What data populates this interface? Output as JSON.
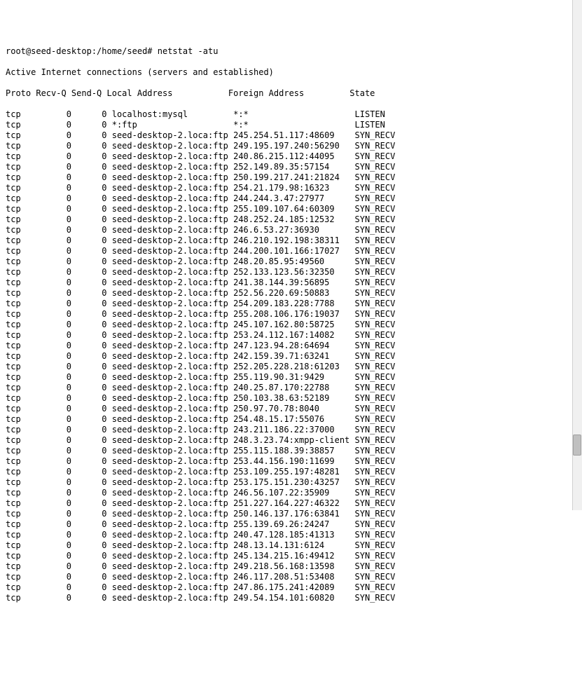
{
  "prompt": "root@seed-desktop:/home/seed# netstat -atu",
  "subtitle": "Active Internet connections (servers and established)",
  "columns": {
    "proto": "Proto",
    "recvq": "Recv-Q",
    "sendq": "Send-Q",
    "local": "Local Address",
    "foreign": "Foreign Address",
    "state": "State"
  },
  "rows": [
    {
      "proto": "tcp",
      "recvq": "0",
      "sendq": "0",
      "local": "localhost:mysql",
      "foreign": "*:*",
      "state": "LISTEN"
    },
    {
      "proto": "tcp",
      "recvq": "0",
      "sendq": "0",
      "local": "*:ftp",
      "foreign": "*:*",
      "state": "LISTEN"
    },
    {
      "proto": "tcp",
      "recvq": "0",
      "sendq": "0",
      "local": "seed-desktop-2.loca:ftp",
      "foreign": "245.254.51.117:48609",
      "state": "SYN_RECV"
    },
    {
      "proto": "tcp",
      "recvq": "0",
      "sendq": "0",
      "local": "seed-desktop-2.loca:ftp",
      "foreign": "249.195.197.240:56290",
      "state": "SYN_RECV"
    },
    {
      "proto": "tcp",
      "recvq": "0",
      "sendq": "0",
      "local": "seed-desktop-2.loca:ftp",
      "foreign": "240.86.215.112:44095",
      "state": "SYN_RECV"
    },
    {
      "proto": "tcp",
      "recvq": "0",
      "sendq": "0",
      "local": "seed-desktop-2.loca:ftp",
      "foreign": "252.149.89.35:57154",
      "state": "SYN_RECV"
    },
    {
      "proto": "tcp",
      "recvq": "0",
      "sendq": "0",
      "local": "seed-desktop-2.loca:ftp",
      "foreign": "250.199.217.241:21824",
      "state": "SYN_RECV"
    },
    {
      "proto": "tcp",
      "recvq": "0",
      "sendq": "0",
      "local": "seed-desktop-2.loca:ftp",
      "foreign": "254.21.179.98:16323",
      "state": "SYN_RECV"
    },
    {
      "proto": "tcp",
      "recvq": "0",
      "sendq": "0",
      "local": "seed-desktop-2.loca:ftp",
      "foreign": "244.244.3.47:27977",
      "state": "SYN_RECV"
    },
    {
      "proto": "tcp",
      "recvq": "0",
      "sendq": "0",
      "local": "seed-desktop-2.loca:ftp",
      "foreign": "255.109.107.64:60309",
      "state": "SYN_RECV"
    },
    {
      "proto": "tcp",
      "recvq": "0",
      "sendq": "0",
      "local": "seed-desktop-2.loca:ftp",
      "foreign": "248.252.24.185:12532",
      "state": "SYN_RECV"
    },
    {
      "proto": "tcp",
      "recvq": "0",
      "sendq": "0",
      "local": "seed-desktop-2.loca:ftp",
      "foreign": "246.6.53.27:36930",
      "state": "SYN_RECV"
    },
    {
      "proto": "tcp",
      "recvq": "0",
      "sendq": "0",
      "local": "seed-desktop-2.loca:ftp",
      "foreign": "246.210.192.198:38311",
      "state": "SYN_RECV"
    },
    {
      "proto": "tcp",
      "recvq": "0",
      "sendq": "0",
      "local": "seed-desktop-2.loca:ftp",
      "foreign": "244.200.101.166:17027",
      "state": "SYN_RECV"
    },
    {
      "proto": "tcp",
      "recvq": "0",
      "sendq": "0",
      "local": "seed-desktop-2.loca:ftp",
      "foreign": "248.20.85.95:49560",
      "state": "SYN_RECV"
    },
    {
      "proto": "tcp",
      "recvq": "0",
      "sendq": "0",
      "local": "seed-desktop-2.loca:ftp",
      "foreign": "252.133.123.56:32350",
      "state": "SYN_RECV"
    },
    {
      "proto": "tcp",
      "recvq": "0",
      "sendq": "0",
      "local": "seed-desktop-2.loca:ftp",
      "foreign": "241.38.144.39:56895",
      "state": "SYN_RECV"
    },
    {
      "proto": "tcp",
      "recvq": "0",
      "sendq": "0",
      "local": "seed-desktop-2.loca:ftp",
      "foreign": "252.56.220.69:50883",
      "state": "SYN_RECV"
    },
    {
      "proto": "tcp",
      "recvq": "0",
      "sendq": "0",
      "local": "seed-desktop-2.loca:ftp",
      "foreign": "254.209.183.228:7788",
      "state": "SYN_RECV"
    },
    {
      "proto": "tcp",
      "recvq": "0",
      "sendq": "0",
      "local": "seed-desktop-2.loca:ftp",
      "foreign": "255.208.106.176:19037",
      "state": "SYN_RECV"
    },
    {
      "proto": "tcp",
      "recvq": "0",
      "sendq": "0",
      "local": "seed-desktop-2.loca:ftp",
      "foreign": "245.107.162.80:58725",
      "state": "SYN_RECV"
    },
    {
      "proto": "tcp",
      "recvq": "0",
      "sendq": "0",
      "local": "seed-desktop-2.loca:ftp",
      "foreign": "253.24.112.167:14082",
      "state": "SYN_RECV"
    },
    {
      "proto": "tcp",
      "recvq": "0",
      "sendq": "0",
      "local": "seed-desktop-2.loca:ftp",
      "foreign": "247.123.94.28:64694",
      "state": "SYN_RECV"
    },
    {
      "proto": "tcp",
      "recvq": "0",
      "sendq": "0",
      "local": "seed-desktop-2.loca:ftp",
      "foreign": "242.159.39.71:63241",
      "state": "SYN_RECV"
    },
    {
      "proto": "tcp",
      "recvq": "0",
      "sendq": "0",
      "local": "seed-desktop-2.loca:ftp",
      "foreign": "252.205.228.218:61203",
      "state": "SYN_RECV"
    },
    {
      "proto": "tcp",
      "recvq": "0",
      "sendq": "0",
      "local": "seed-desktop-2.loca:ftp",
      "foreign": "255.119.90.31:9429",
      "state": "SYN_RECV"
    },
    {
      "proto": "tcp",
      "recvq": "0",
      "sendq": "0",
      "local": "seed-desktop-2.loca:ftp",
      "foreign": "240.25.87.170:22788",
      "state": "SYN_RECV"
    },
    {
      "proto": "tcp",
      "recvq": "0",
      "sendq": "0",
      "local": "seed-desktop-2.loca:ftp",
      "foreign": "250.103.38.63:52189",
      "state": "SYN_RECV"
    },
    {
      "proto": "tcp",
      "recvq": "0",
      "sendq": "0",
      "local": "seed-desktop-2.loca:ftp",
      "foreign": "250.97.70.78:8040",
      "state": "SYN_RECV"
    },
    {
      "proto": "tcp",
      "recvq": "0",
      "sendq": "0",
      "local": "seed-desktop-2.loca:ftp",
      "foreign": "254.48.15.17:55076",
      "state": "SYN_RECV"
    },
    {
      "proto": "tcp",
      "recvq": "0",
      "sendq": "0",
      "local": "seed-desktop-2.loca:ftp",
      "foreign": "243.211.186.22:37000",
      "state": "SYN_RECV"
    },
    {
      "proto": "tcp",
      "recvq": "0",
      "sendq": "0",
      "local": "seed-desktop-2.loca:ftp",
      "foreign": "248.3.23.74:xmpp-client",
      "state": "SYN_RECV"
    },
    {
      "proto": "tcp",
      "recvq": "0",
      "sendq": "0",
      "local": "seed-desktop-2.loca:ftp",
      "foreign": "255.115.188.39:38857",
      "state": "SYN_RECV"
    },
    {
      "proto": "tcp",
      "recvq": "0",
      "sendq": "0",
      "local": "seed-desktop-2.loca:ftp",
      "foreign": "253.44.156.190:11699",
      "state": "SYN_RECV"
    },
    {
      "proto": "tcp",
      "recvq": "0",
      "sendq": "0",
      "local": "seed-desktop-2.loca:ftp",
      "foreign": "253.109.255.197:48281",
      "state": "SYN_RECV"
    },
    {
      "proto": "tcp",
      "recvq": "0",
      "sendq": "0",
      "local": "seed-desktop-2.loca:ftp",
      "foreign": "253.175.151.230:43257",
      "state": "SYN_RECV"
    },
    {
      "proto": "tcp",
      "recvq": "0",
      "sendq": "0",
      "local": "seed-desktop-2.loca:ftp",
      "foreign": "246.56.107.22:35909",
      "state": "SYN_RECV"
    },
    {
      "proto": "tcp",
      "recvq": "0",
      "sendq": "0",
      "local": "seed-desktop-2.loca:ftp",
      "foreign": "251.227.164.227:46322",
      "state": "SYN_RECV"
    },
    {
      "proto": "tcp",
      "recvq": "0",
      "sendq": "0",
      "local": "seed-desktop-2.loca:ftp",
      "foreign": "250.146.137.176:63841",
      "state": "SYN_RECV"
    },
    {
      "proto": "tcp",
      "recvq": "0",
      "sendq": "0",
      "local": "seed-desktop-2.loca:ftp",
      "foreign": "255.139.69.26:24247",
      "state": "SYN_RECV"
    },
    {
      "proto": "tcp",
      "recvq": "0",
      "sendq": "0",
      "local": "seed-desktop-2.loca:ftp",
      "foreign": "240.47.128.185:41313",
      "state": "SYN_RECV"
    },
    {
      "proto": "tcp",
      "recvq": "0",
      "sendq": "0",
      "local": "seed-desktop-2.loca:ftp",
      "foreign": "248.13.14.131:6124",
      "state": "SYN_RECV"
    },
    {
      "proto": "tcp",
      "recvq": "0",
      "sendq": "0",
      "local": "seed-desktop-2.loca:ftp",
      "foreign": "245.134.215.16:49412",
      "state": "SYN_RECV"
    },
    {
      "proto": "tcp",
      "recvq": "0",
      "sendq": "0",
      "local": "seed-desktop-2.loca:ftp",
      "foreign": "249.218.56.168:13598",
      "state": "SYN_RECV"
    },
    {
      "proto": "tcp",
      "recvq": "0",
      "sendq": "0",
      "local": "seed-desktop-2.loca:ftp",
      "foreign": "246.117.208.51:53408",
      "state": "SYN_RECV"
    },
    {
      "proto": "tcp",
      "recvq": "0",
      "sendq": "0",
      "local": "seed-desktop-2.loca:ftp",
      "foreign": "247.86.175.241:42089",
      "state": "SYN_RECV"
    },
    {
      "proto": "tcp",
      "recvq": "0",
      "sendq": "0",
      "local": "seed-desktop-2.loca:ftp",
      "foreign": "249.54.154.101:60820",
      "state": "SYN_RECV"
    }
  ]
}
